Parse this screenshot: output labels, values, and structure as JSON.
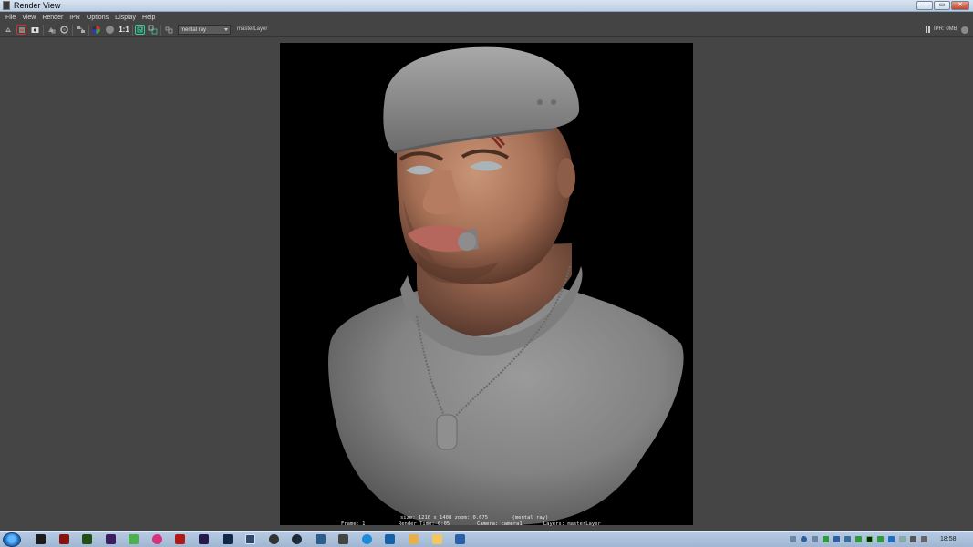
{
  "window": {
    "title": "Render View",
    "controls": [
      "–",
      "▭",
      "✕"
    ]
  },
  "menubar": {
    "items": [
      "File",
      "View",
      "Render",
      "IPR",
      "Options",
      "Display",
      "Help"
    ]
  },
  "toolbar": {
    "icons": [
      "redo-render-icon",
      "ipr-render-icon",
      "snapshot-icon",
      "render-region-icon",
      "refresh-icon",
      "keep-image-icon",
      "color-channel-icon",
      "alpha-channel-icon",
      "real-size-icon",
      "display-options-icon",
      "compare-icon",
      "log-icon"
    ],
    "real_size_label": "1:1",
    "renderer": "mental ray",
    "layer": "masterLayer",
    "ipr_status": "IPR: 0MB"
  },
  "render_info": {
    "line1": "size: 1210 x 1408 zoom: 0.675        (mental ray)",
    "line2": "Frame: 1           Render Time: 0:05         Camera: camera1       Layers: masterLayer"
  },
  "taskbar": {
    "clock": "18:58",
    "apps": [
      "unity-icon",
      "app-red-icon",
      "dreamweaver-icon",
      "premiere-icon",
      "chrome-icon",
      "itunes-icon",
      "acrobat-icon",
      "after-effects-icon",
      "photoshop-icon",
      "maya-icon",
      "unreal-icon",
      "steam-icon",
      "photo-viewer-icon",
      "inkscape-icon",
      "skype-icon",
      "outlook-icon",
      "explorer-icon",
      "folder-icon",
      "word-icon"
    ],
    "colors": {
      "taskbar": "#a8bdd8",
      "accent_green": "#2f9a3a",
      "accent_blue": "#1d6fc4"
    }
  }
}
